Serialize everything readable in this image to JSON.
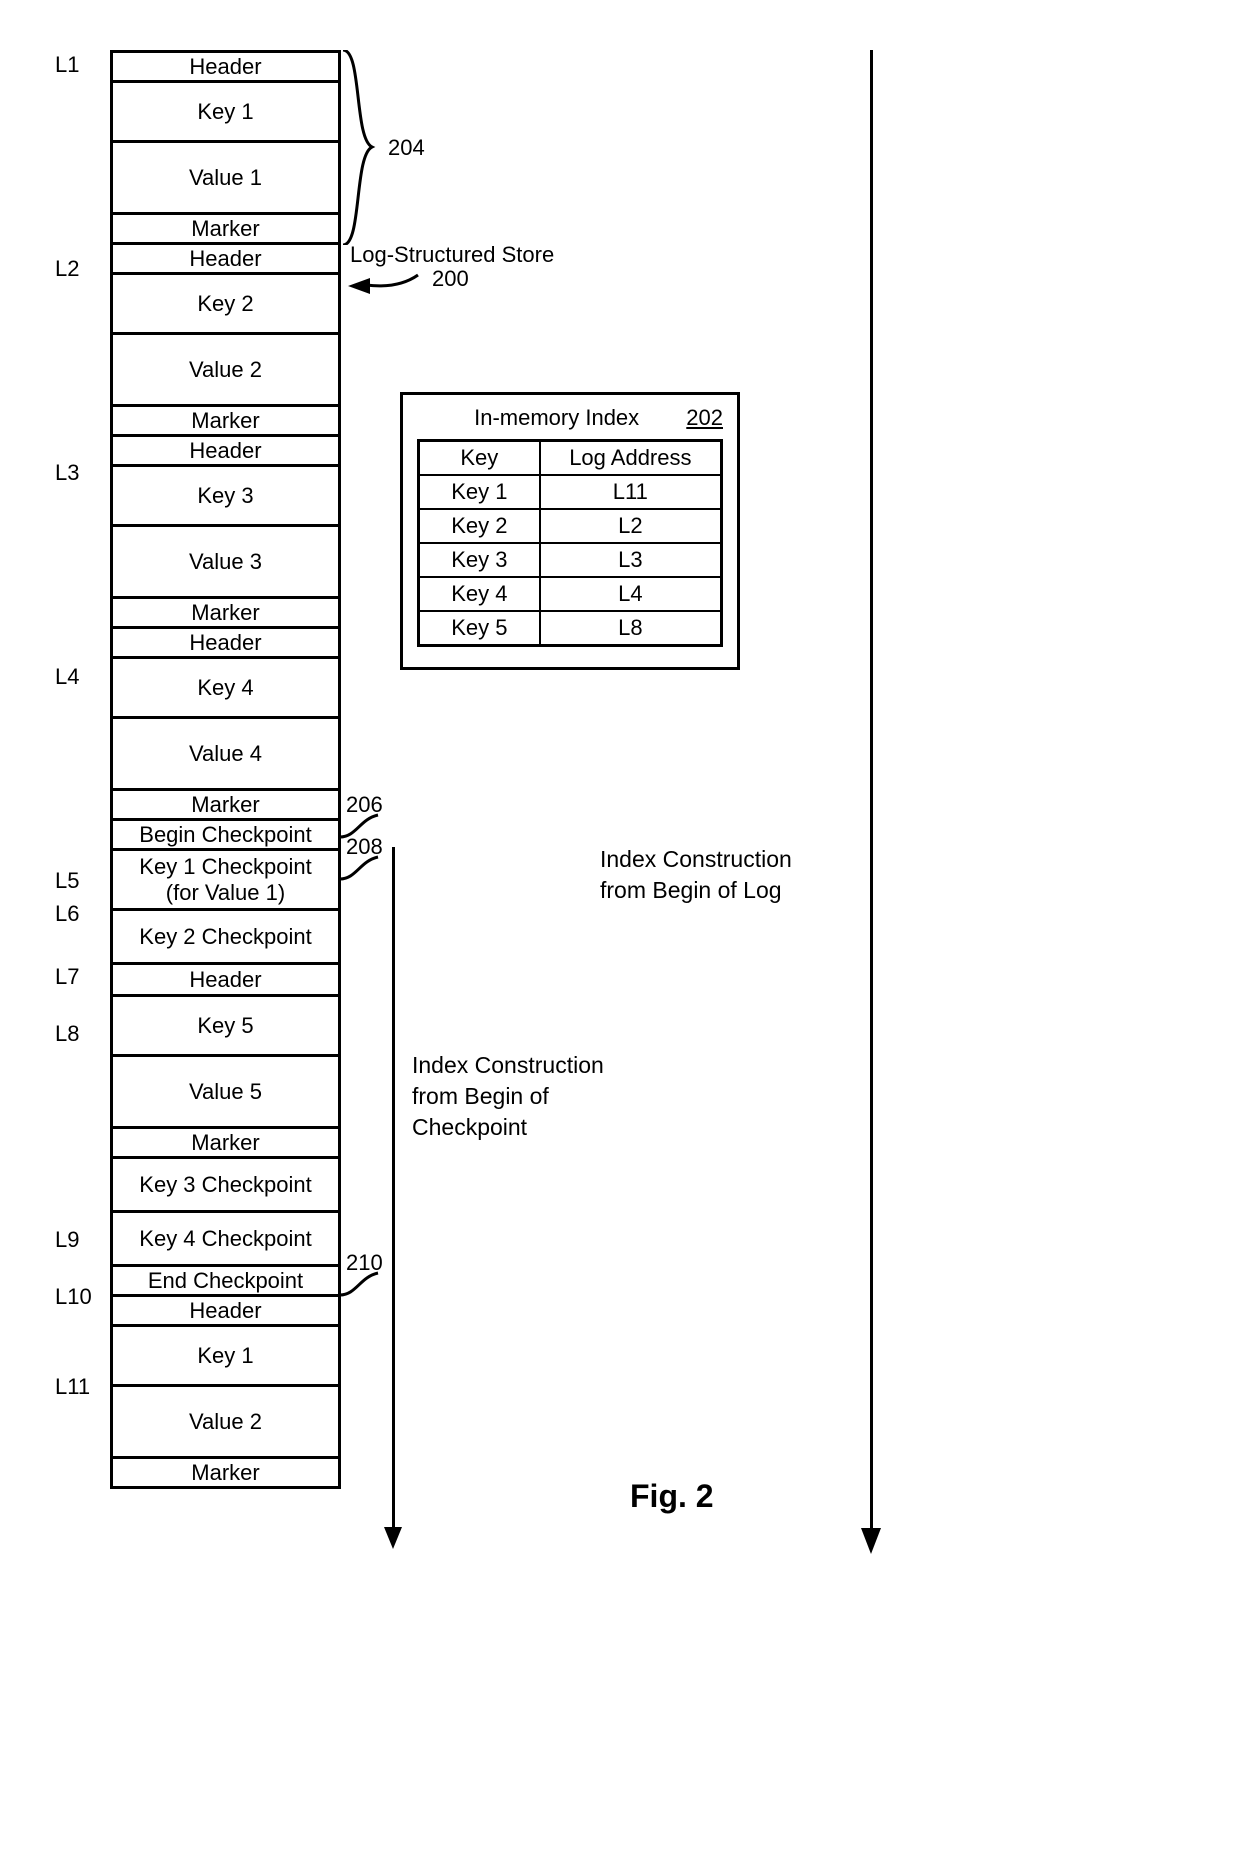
{
  "log_store_label": "Log-Structured Store",
  "ref_labels": {
    "r200": "200",
    "r202": "202",
    "r204": "204",
    "r206": "206",
    "r208": "208",
    "r210": "210"
  },
  "figure_caption": "Fig. 2",
  "index_construction_log": "Index Construction\nfrom Begin of Log",
  "index_construction_ckpt": "Index Construction\nfrom Begin of\nCheckpoint",
  "index_box_title": "In-memory Index",
  "index_table": {
    "headers": [
      "Key",
      "Log Address"
    ],
    "rows": [
      [
        "Key 1",
        "L11"
      ],
      [
        "Key 2",
        "L2"
      ],
      [
        "Key 3",
        "L3"
      ],
      [
        "Key 4",
        "L4"
      ],
      [
        "Key 5",
        "L8"
      ]
    ]
  },
  "l_labels": {
    "L1": "L1",
    "L2": "L2",
    "L3": "L3",
    "L4": "L4",
    "L5": "L5",
    "L6": "L6",
    "L7": "L7",
    "L8": "L8",
    "L9": "L9",
    "L10": "L10",
    "L11": "L11"
  },
  "log_entries": [
    {
      "id": "l1-header",
      "cls": "h-header",
      "label": "Header",
      "L": "L1"
    },
    {
      "id": "l1-key",
      "cls": "h-key",
      "label": "Key 1"
    },
    {
      "id": "l1-value",
      "cls": "h-value",
      "label": "Value 1"
    },
    {
      "id": "l1-marker",
      "cls": "h-marker",
      "label": "Marker"
    },
    {
      "id": "l2-header",
      "cls": "h-header",
      "label": "Header",
      "L": "L2"
    },
    {
      "id": "l2-key",
      "cls": "h-key",
      "label": "Key 2"
    },
    {
      "id": "l2-value",
      "cls": "h-value",
      "label": "Value 2"
    },
    {
      "id": "l2-marker",
      "cls": "h-marker",
      "label": "Marker"
    },
    {
      "id": "l3-header",
      "cls": "h-header",
      "label": "Header",
      "L": "L3"
    },
    {
      "id": "l3-key",
      "cls": "h-key",
      "label": "Key 3"
    },
    {
      "id": "l3-value",
      "cls": "h-value",
      "label": "Value 3"
    },
    {
      "id": "l3-marker",
      "cls": "h-marker",
      "label": "Marker"
    },
    {
      "id": "l4-header",
      "cls": "h-header",
      "label": "Header",
      "L": "L4"
    },
    {
      "id": "l4-key",
      "cls": "h-key",
      "label": "Key 4"
    },
    {
      "id": "l4-value",
      "cls": "h-value",
      "label": "Value 4"
    },
    {
      "id": "l4-marker",
      "cls": "h-marker",
      "label": "Marker"
    },
    {
      "id": "l5-begin",
      "cls": "h-ckpt",
      "label": "Begin Checkpoint",
      "L": "L5"
    },
    {
      "id": "l6-k1ckpt",
      "cls": "h-ckpt-k1",
      "label": "Key 1 Checkpoint\n(for Value 1)",
      "L": "L6"
    },
    {
      "id": "l7-k2ckpt",
      "cls": "h-ckpt-kx",
      "label": "Key 2 Checkpoint",
      "L": "L7"
    },
    {
      "id": "l8-header",
      "cls": "h-header-l8",
      "label": "Header",
      "L": "L8"
    },
    {
      "id": "l8-key",
      "cls": "h-key",
      "label": "Key 5"
    },
    {
      "id": "l8-value",
      "cls": "h-value",
      "label": "Value 5"
    },
    {
      "id": "l8-marker",
      "cls": "h-marker",
      "label": "Marker"
    },
    {
      "id": "l9-k3ckpt",
      "cls": "h-ckpt-kx",
      "label": "Key 3 Checkpoint",
      "L": "L9"
    },
    {
      "id": "l10-k4ckpt",
      "cls": "h-ckpt-kx",
      "label": "Key 4 Checkpoint",
      "L": "L10"
    },
    {
      "id": "end-ckpt",
      "cls": "h-ckpt",
      "label": "End Checkpoint"
    },
    {
      "id": "l11-header",
      "cls": "h-header",
      "label": "Header",
      "L": "L11"
    },
    {
      "id": "l11-key",
      "cls": "h-key",
      "label": "Key 1"
    },
    {
      "id": "l11-value",
      "cls": "h-value",
      "label": "Value 2"
    },
    {
      "id": "l11-marker",
      "cls": "h-marker",
      "label": "Marker"
    }
  ]
}
